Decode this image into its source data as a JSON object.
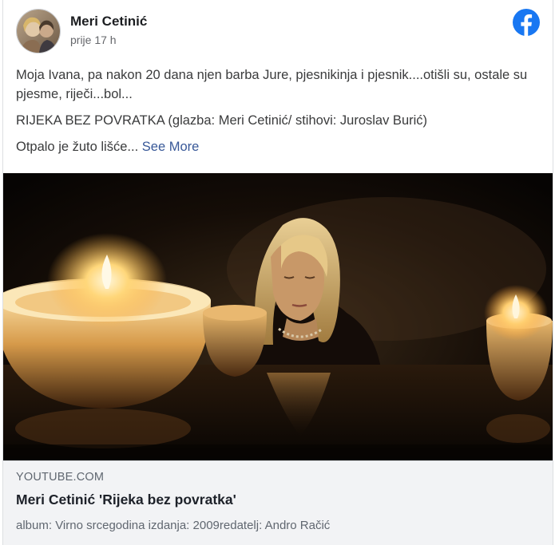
{
  "post": {
    "author_name": "Meri Cetinić",
    "timestamp": "prije 17 h",
    "text": {
      "line1": "Moja Ivana, pa nakon 20 dana njen barba Jure, pjesnikinja i pjesnik....otišli su, ostale su pjesme, riječi...bol...",
      "line2": "RIJEKA BEZ POVRATKA (glazba: Meri Cetinić/ stihovi: Juroslav Burić)",
      "line3": "Otpalo je žuto lišće...",
      "see_more": "See More"
    }
  },
  "brand": {
    "icon": "facebook-logo-icon",
    "color": "#1877f2"
  },
  "link_preview": {
    "domain": "YOUTUBE.COM",
    "title": "Meri Cetinić 'Rijeka bez povratka'",
    "description": "album: Virno srcegodina izdanja: 2009redatelj: Andro Račić"
  },
  "colors": {
    "link": "#385898",
    "secondary_text": "#65676b",
    "preview_bg": "#f2f3f5"
  }
}
